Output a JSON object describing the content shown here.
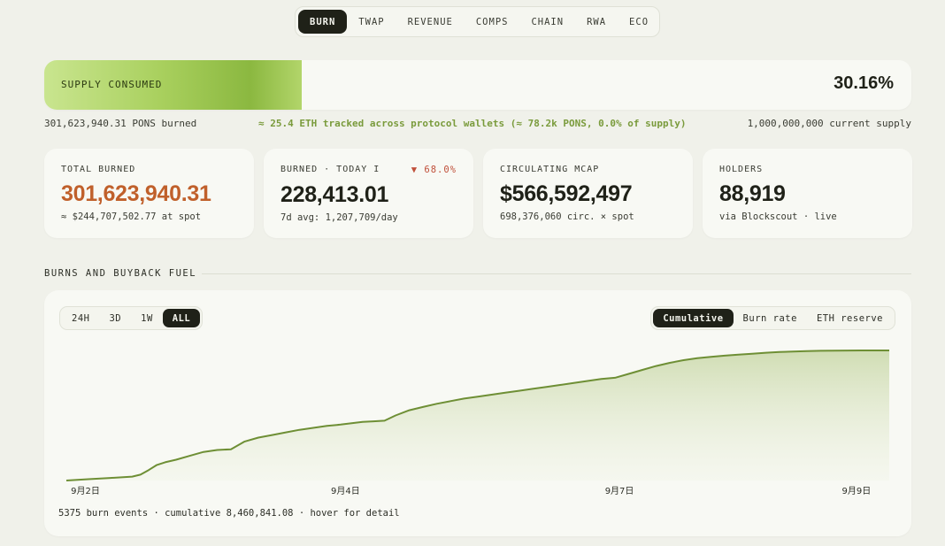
{
  "nav": {
    "tabs": [
      "BURN",
      "TWAP",
      "REVENUE",
      "COMPS",
      "CHAIN",
      "RWA",
      "ECO"
    ],
    "active": "BURN"
  },
  "supply": {
    "label": "SUPPLY CONSUMED",
    "percent_text": "30.16%",
    "percent": 0.3016,
    "burned_text": "301,623,940.31 PONS burned",
    "tracked_text": "≈ 25.4 ETH tracked across protocol wallets (≈ 78.2k PONS, 0.0% of supply)",
    "supply_text": "1,000,000,000 current supply"
  },
  "cards": [
    {
      "label": "TOTAL BURNED",
      "value": "301,623,940.31",
      "sub": "≈ $244,707,502.77 at spot"
    },
    {
      "label": "BURNED · TODAY I",
      "delta": "▼ 68.0%",
      "value": "228,413.01",
      "sub": "7d avg: 1,207,709/day"
    },
    {
      "label": "CIRCULATING MCAP",
      "value": "$566,592,497",
      "sub": "698,376,060 circ. × spot"
    },
    {
      "label": "HOLDERS",
      "value": "88,919",
      "sub": "via Blockscout · live"
    }
  ],
  "section": {
    "title": "BURNS AND BUYBACK FUEL"
  },
  "chart": {
    "ranges": [
      "24H",
      "3D",
      "1W",
      "ALL"
    ],
    "active_range": "ALL",
    "modes": [
      "Cumulative",
      "Burn rate",
      "ETH reserve"
    ],
    "active_mode": "Cumulative",
    "footer": "5375 burn events · cumulative 8,460,841.08 · hover for detail",
    "line_color": "#6e8f35",
    "fill_color": "#cfdcb3"
  },
  "chart_data": {
    "type": "area",
    "x_tick_labels": [
      "9月2日",
      "9月4日",
      "9月7日",
      "9月9日"
    ],
    "x": [
      0,
      8,
      16,
      24,
      27,
      30,
      33,
      36,
      40,
      45,
      50,
      55,
      60,
      65,
      70,
      75,
      80,
      85,
      90,
      95,
      100,
      104,
      108,
      112,
      116,
      120,
      125,
      130,
      135,
      140,
      145,
      150,
      155,
      160,
      165,
      170,
      175,
      180,
      185,
      190,
      195,
      200,
      205,
      210,
      215,
      220,
      225,
      230,
      235,
      240,
      245,
      250,
      255,
      260,
      265,
      270,
      275,
      280,
      285,
      290,
      295,
      300
    ],
    "y": [
      0.0,
      0.01,
      0.02,
      0.03,
      0.045,
      0.08,
      0.12,
      0.14,
      0.16,
      0.19,
      0.22,
      0.235,
      0.24,
      0.3,
      0.33,
      0.35,
      0.37,
      0.39,
      0.405,
      0.42,
      0.43,
      0.44,
      0.45,
      0.455,
      0.46,
      0.5,
      0.54,
      0.565,
      0.59,
      0.61,
      0.63,
      0.645,
      0.66,
      0.675,
      0.69,
      0.705,
      0.72,
      0.735,
      0.75,
      0.765,
      0.78,
      0.79,
      0.82,
      0.85,
      0.88,
      0.905,
      0.925,
      0.94,
      0.95,
      0.96,
      0.968,
      0.975,
      0.982,
      0.988,
      0.992,
      0.995,
      0.997,
      0.998,
      0.999,
      1.0,
      1.0,
      1.0
    ],
    "ylim": [
      0,
      1
    ],
    "grid": false,
    "legend": "none"
  }
}
